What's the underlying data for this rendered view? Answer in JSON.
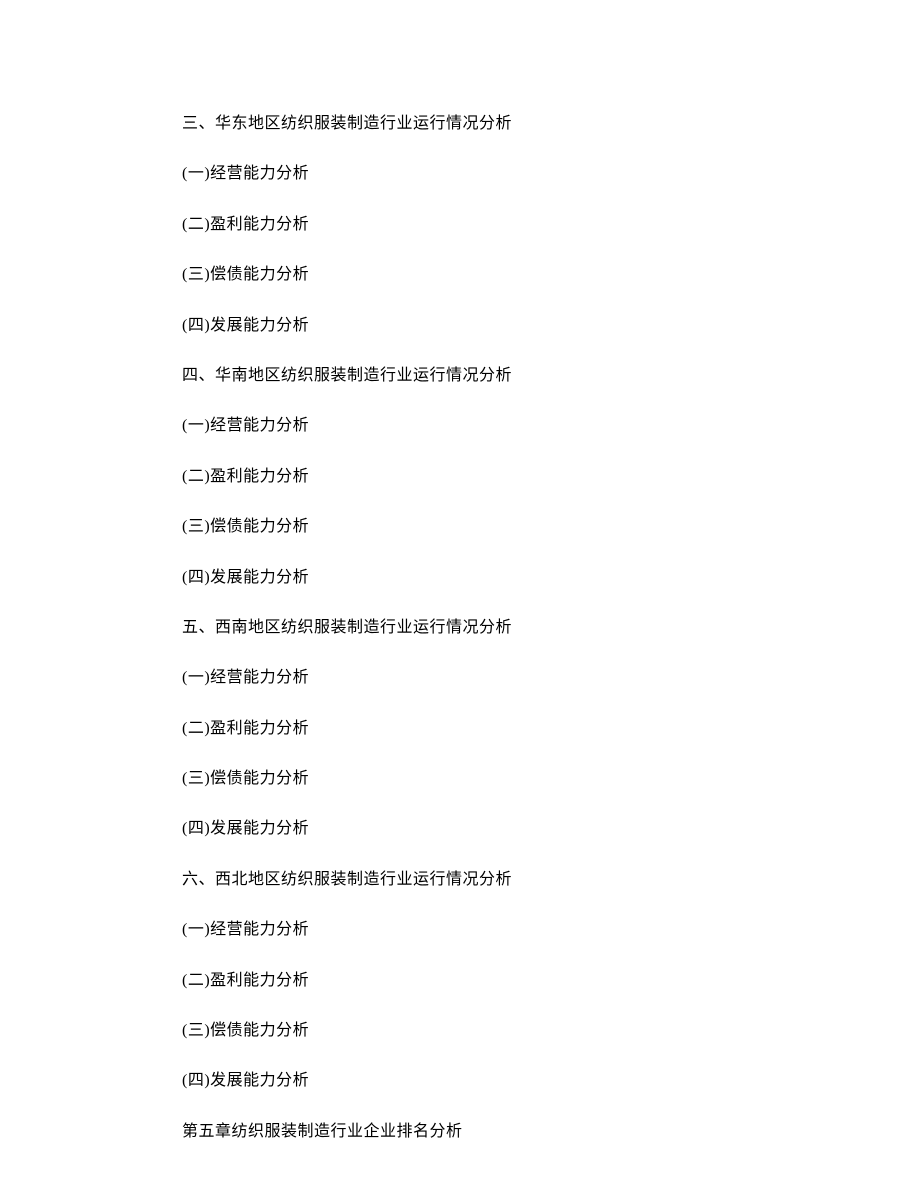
{
  "lines": [
    "三、华东地区纺织服装制造行业运行情况分析",
    "(一)经营能力分析",
    "(二)盈利能力分析",
    "(三)偿债能力分析",
    "(四)发展能力分析",
    "四、华南地区纺织服装制造行业运行情况分析",
    "(一)经营能力分析",
    "(二)盈利能力分析",
    "(三)偿债能力分析",
    "(四)发展能力分析",
    "五、西南地区纺织服装制造行业运行情况分析",
    "(一)经营能力分析",
    "(二)盈利能力分析",
    "(三)偿债能力分析",
    "(四)发展能力分析",
    "六、西北地区纺织服装制造行业运行情况分析",
    "(一)经营能力分析",
    "(二)盈利能力分析",
    "(三)偿债能力分析",
    "(四)发展能力分析",
    "第五章纺织服装制造行业企业排名分析"
  ]
}
